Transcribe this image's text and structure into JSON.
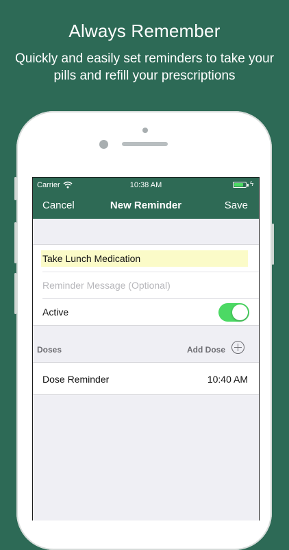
{
  "promo": {
    "headline": "Always Remember",
    "subline": "Quickly and easily set reminders to take your pills and refill your prescriptions"
  },
  "status_bar": {
    "carrier": "Carrier",
    "time": "10:38 AM",
    "wifi_icon": "wifi-icon",
    "battery_icon": "battery-icon",
    "battery_level": 0.8
  },
  "nav": {
    "cancel_label": "Cancel",
    "title": "New Reminder",
    "save_label": "Save"
  },
  "form": {
    "reminder_name": "Take Lunch Medication",
    "message_placeholder": "Reminder Message (Optional)",
    "active_label": "Active",
    "active_on": true
  },
  "doses": {
    "header_label": "Doses",
    "add_label": "Add Dose",
    "add_icon": "plus-circle-icon",
    "items": [
      {
        "name": "Dose Reminder",
        "time": "10:40 AM"
      }
    ]
  },
  "colors": {
    "background": "#2d6a56",
    "nav_bar": "#2e6a55",
    "toggle_on": "#4cd964",
    "highlight_field": "#fbfbc8"
  }
}
